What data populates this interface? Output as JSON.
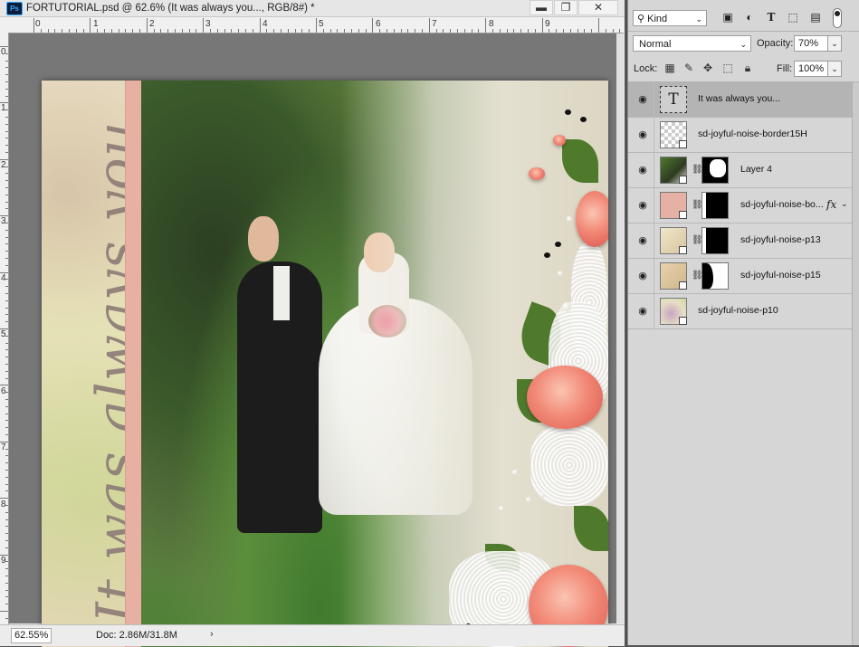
{
  "document": {
    "title": "FORTUTORIAL.psd @ 62.6% (It was always you..., RGB/8#) *",
    "app_badge": "Ps",
    "window_buttons": {
      "minimize": "▬",
      "restore": "❐",
      "close": "✕"
    },
    "ruler_top_numbers": [
      "0",
      "1",
      "2",
      "3",
      "4",
      "5",
      "6",
      "7",
      "8",
      "9"
    ],
    "ruler_left_numbers": [
      "0",
      "1",
      "2",
      "3",
      "4",
      "5",
      "6",
      "7",
      "8",
      "9"
    ],
    "canvas_text": "It was always you..."
  },
  "status_bar": {
    "zoom": "62.55%",
    "doc_info": "Doc: 2.86M/31.8M",
    "arrow": "›"
  },
  "layers_panel": {
    "filter": {
      "kind_label": "Kind",
      "icons": [
        "image-filter-icon",
        "adjustment-filter-icon",
        "type-filter-icon",
        "shape-filter-icon",
        "smart-object-filter-icon"
      ]
    },
    "blend_mode": "Normal",
    "opacity_label": "Opacity:",
    "opacity_value": "70%",
    "lock_label": "Lock:",
    "fill_label": "Fill:",
    "fill_value": "100%",
    "layers": [
      {
        "name": "It was always you...",
        "type": "text",
        "selected": true,
        "visible": true
      },
      {
        "name": "sd-joyful-noise-border15H",
        "type": "smart",
        "visible": true
      },
      {
        "name": "Layer 4",
        "type": "masked-photo",
        "visible": true
      },
      {
        "name": "sd-joyful-noise-bo...",
        "type": "masked-pink",
        "fx": "fx",
        "visible": true
      },
      {
        "name": "sd-joyful-noise-p13",
        "type": "masked-paper",
        "visible": true
      },
      {
        "name": "sd-joyful-noise-p15",
        "type": "masked-paper2",
        "visible": true
      },
      {
        "name": "sd-joyful-noise-p10",
        "type": "smart-p10",
        "visible": true
      }
    ]
  }
}
